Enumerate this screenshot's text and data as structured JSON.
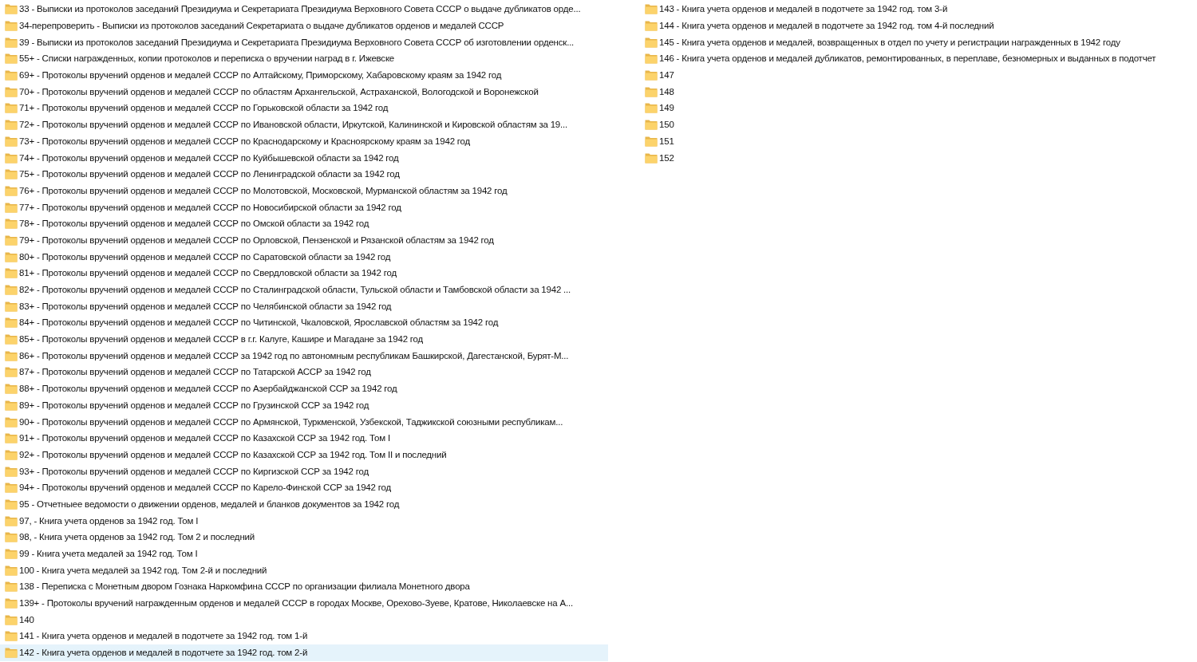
{
  "items": [
    {
      "name": "33 - Выписки из протоколов заседаний Президиума и Секретариата Президиума Верховного Совета СССР о выдаче дубликатов орде...",
      "selected": false
    },
    {
      "name": "34-перепроверить - Выписки из протоколов заседаний Секретариата о выдаче дубликатов орденов и медалей СССР",
      "selected": false
    },
    {
      "name": "39 - Выписки из протоколов заседаний Президиума и Секретариата Президиума Верховного Совета СССР об изготовлении орденск...",
      "selected": false
    },
    {
      "name": "55+ - Списки награжденных, копии протоколов и переписка о вручении наград в г. Ижевске",
      "selected": false
    },
    {
      "name": "69+ - Протоколы вручений орденов и медалей СССР по Алтайскому, Приморскому, Хабаровскому краям за 1942 год",
      "selected": false
    },
    {
      "name": "70+ - Протоколы вручений орденов и медалей СССР по областям Архангельской, Астраханской, Вологодской и Воронежской",
      "selected": false
    },
    {
      "name": "71+ - Протоколы вручений орденов и медалей СССР по Горьковской области за 1942 год",
      "selected": false
    },
    {
      "name": "72+ - Протоколы вручений орденов и медалей СССР по Ивановской области, Иркутской, Калининской и Кировской областям за 19...",
      "selected": false
    },
    {
      "name": "73+ - Протоколы вручений орденов и медалей СССР по Краснодарскому и Красноярскому краям за 1942 год",
      "selected": false
    },
    {
      "name": "74+ - Протоколы вручений орденов и медалей СССР по Куйбышевской области за 1942 год",
      "selected": false
    },
    {
      "name": "75+ - Протоколы вручений орденов и медалей СССР по Ленинградской области за 1942 год",
      "selected": false
    },
    {
      "name": "76+ - Протоколы вручений орденов и медалей СССР по Молотовской, Московской, Мурманской областям за 1942 год",
      "selected": false
    },
    {
      "name": "77+ - Протоколы вручений орденов и медалей СССР по Новосибирской области за 1942 год",
      "selected": false
    },
    {
      "name": "78+ - Протоколы вручений орденов и медалей СССР по Омской области за 1942 год",
      "selected": false
    },
    {
      "name": "79+ - Протоколы вручений орденов и медалей СССР по Орловской, Пензенской и Рязанской областям за 1942 год",
      "selected": false
    },
    {
      "name": "80+ - Протоколы вручений орденов и медалей СССР по Саратовской области за 1942 год",
      "selected": false
    },
    {
      "name": "81+ - Протоколы вручений орденов и медалей СССР по Свердловской области за 1942 год",
      "selected": false
    },
    {
      "name": "82+ - Протоколы вручений орденов и медалей СССР по Сталинградской области, Тульской области и Тамбовской области за 1942 ...",
      "selected": false
    },
    {
      "name": "83+ - Протоколы вручений орденов и медалей СССР по Челябинской области за 1942 год",
      "selected": false
    },
    {
      "name": "84+ - Протоколы вручений орденов и медалей СССР по Читинской, Чкаловской, Ярославской областям за 1942 год",
      "selected": false
    },
    {
      "name": "85+ - Протоколы вручений орденов и медалей СССР в г.г. Калуге, Кашире и Магадане за 1942 год",
      "selected": false
    },
    {
      "name": "86+ - Протоколы вручений орденов и медалей СССР за 1942 год по автономным республикам Башкирской, Дагестанской, Бурят-М...",
      "selected": false
    },
    {
      "name": "87+ - Протоколы вручений орденов и медалей СССР по Татарской АССР за 1942 год",
      "selected": false
    },
    {
      "name": "88+ - Протоколы вручений орденов и медалей СССР по Азербайджанской ССР за 1942 год",
      "selected": false
    },
    {
      "name": "89+ - Протоколы вручений орденов и медалей СССР по Грузинской ССР за 1942 год",
      "selected": false
    },
    {
      "name": "90+ - Протоколы вручений орденов и медалей СССР по Армянской, Туркменской, Узбекской, Таджикской союзными республикам...",
      "selected": false
    },
    {
      "name": "91+ - Протоколы вручений орденов и медалей СССР по Казахской ССР за 1942 год. Том I",
      "selected": false
    },
    {
      "name": "92+ - Протоколы вручений орденов и медалей СССР по Казахской ССР за 1942 год. Том II и последний",
      "selected": false
    },
    {
      "name": "93+ - Протоколы вручений орденов и медалей СССР по Киргизской ССР за 1942 год",
      "selected": false
    },
    {
      "name": "94+ - Протоколы вручений орденов и медалей СССР по Карело-Финской ССР за 1942 год",
      "selected": false
    },
    {
      "name": "95 - Отчетныее ведомости о движении орденов, медалей и бланков документов за 1942 год",
      "selected": false
    },
    {
      "name": "97, - Книга учета орденов за 1942 год. Том I",
      "selected": false
    },
    {
      "name": "98, - Книга учета орденов за 1942 год. Том 2 и последний",
      "selected": false
    },
    {
      "name": "99 - Книга учета медалей за 1942 год. Том I",
      "selected": false
    },
    {
      "name": "100 - Книга учета медалей за 1942 год. Том 2-й и последний",
      "selected": false
    },
    {
      "name": "138 - Переписка с Монетным двором Гознака Наркомфина СССР по организации филиала Монетного двора",
      "selected": false
    },
    {
      "name": "139+ - Протоколы вручений награжденным орденов и медалей СССР в городах Москве, Орехово-Зуеве, Кратове, Николаевске на А...",
      "selected": false
    },
    {
      "name": "140",
      "selected": false
    },
    {
      "name": "141 - Книга учета орденов и медалей в подотчете за 1942 год. том 1-й",
      "selected": false
    },
    {
      "name": "142 - Книга учета орденов и медалей в подотчете за 1942 год. том 2-й",
      "selected": true
    },
    {
      "name": "143 - Книга учета орденов и медалей в подотчете за 1942 год. том 3-й",
      "selected": false
    },
    {
      "name": "144 - Книга учета орденов и медалей в подотчете за 1942 год. том 4-й последний",
      "selected": false
    },
    {
      "name": "145 - Книга учета орденов и медалей, возвращенных в отдел по учету и регистрации награжденных в 1942 году",
      "selected": false
    },
    {
      "name": "146 - Книга учета орденов и медалей дубликатов, ремонтированных, в переплаве, безномерных и выданных в подотчет",
      "selected": false
    },
    {
      "name": "147",
      "selected": false
    },
    {
      "name": "148",
      "selected": false
    },
    {
      "name": "149",
      "selected": false
    },
    {
      "name": "150",
      "selected": false
    },
    {
      "name": "151",
      "selected": false
    },
    {
      "name": "152",
      "selected": false
    }
  ]
}
